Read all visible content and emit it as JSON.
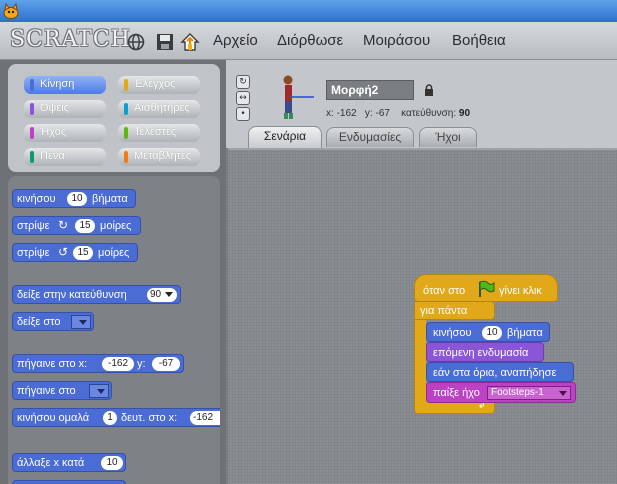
{
  "app": {
    "logo": "SCRATCH",
    "menu": [
      "Αρχείο",
      "Διόρθωσε",
      "Μοιράσου",
      "Βοήθεια"
    ]
  },
  "categories": [
    {
      "label": "Κίνηση",
      "color": "#4a6cd4",
      "selected": true
    },
    {
      "label": "Έλεγχος",
      "color": "#e1a91a"
    },
    {
      "label": "Όψεις",
      "color": "#8a55d7"
    },
    {
      "label": "Αισθητήρες",
      "color": "#0c9fc9"
    },
    {
      "label": "Ήχος",
      "color": "#bb42c3"
    },
    {
      "label": "Τελεστές",
      "color": "#5cb712"
    },
    {
      "label": "Πένα",
      "color": "#0e9a6c"
    },
    {
      "label": "Μεταβλητές",
      "color": "#ee7d16"
    }
  ],
  "palette_blocks": {
    "move": {
      "label": "κινήσου",
      "value": "10",
      "suffix": "βήματα"
    },
    "turn_right": {
      "label": "στρίψε",
      "glyph": "↻",
      "value": "15",
      "suffix": "μοίρες"
    },
    "turn_left": {
      "label": "στρίψε",
      "glyph": "↺",
      "value": "15",
      "suffix": "μοίρες"
    },
    "point_dir": {
      "label": "δείξε στην κατεύθυνση",
      "value": "90"
    },
    "point_to": {
      "label": "δείξε στο"
    },
    "goto_xy": {
      "label": "πήγαινε στο x:",
      "x": "-162",
      "ylabel": "y:",
      "y": "-67"
    },
    "goto": {
      "label": "πήγαινε στο"
    },
    "glide": {
      "label": "κινήσου ομαλά",
      "value": "1",
      "mid": "δευτ. στο x:",
      "x": "-162"
    },
    "change_x": {
      "label": "άλλαξε x κατά",
      "value": "10"
    }
  },
  "sprite": {
    "name": "Μορφή2",
    "x_label": "x:",
    "x": "-162",
    "y_label": "y:",
    "y": "-67",
    "dir_label": "κατεύθυνση:",
    "direction": "90"
  },
  "tabs": [
    "Σενάρια",
    "Ενδυμασίες",
    "Ήχοι"
  ],
  "script": {
    "hat": {
      "pre": "όταν στο",
      "post": "γίνει κλικ"
    },
    "forever": "για πάντα",
    "move": {
      "label": "κινήσου",
      "value": "10",
      "suffix": "βήματα"
    },
    "next_costume": "επόμενη ενδυμασία",
    "bounce": "εάν στα όρια, αναπήδησε",
    "play_sound": {
      "label": "παίξε ήχο",
      "value": "Footsteps-1"
    }
  },
  "colors": {
    "motion": "#4a6cd4",
    "looks": "#8a55d7",
    "sound": "#bb42c3",
    "control": "#e1a91a"
  }
}
